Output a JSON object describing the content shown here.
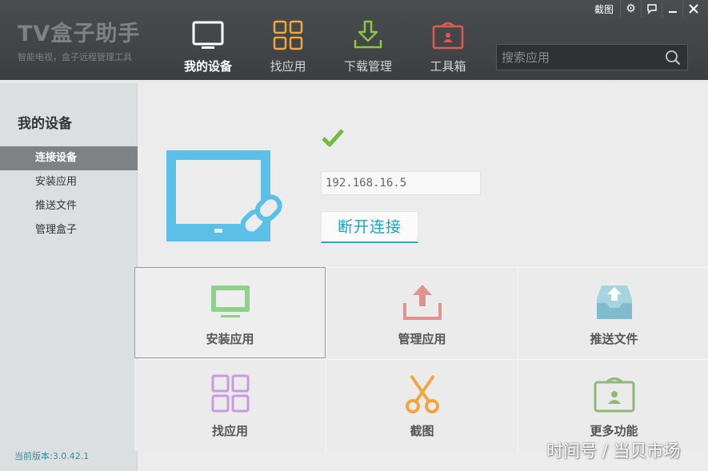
{
  "app": {
    "title": "TV盒子助手",
    "subtitle": "智能电视，盒子远程管理工具"
  },
  "window_controls": {
    "screenshot_label": "截图",
    "icons": [
      "gear-icon",
      "chat-icon",
      "minimize-icon",
      "close-icon"
    ]
  },
  "nav": {
    "tabs": [
      {
        "label": "我的设备",
        "icon": "tv-icon",
        "active": true
      },
      {
        "label": "找应用",
        "icon": "grid-icon",
        "active": false
      },
      {
        "label": "下载管理",
        "icon": "download-icon",
        "active": false
      },
      {
        "label": "工具箱",
        "icon": "toolbox-icon",
        "active": false
      }
    ]
  },
  "search": {
    "placeholder": "搜索应用",
    "value": ""
  },
  "sidebar": {
    "title": "我的设备",
    "items": [
      {
        "label": "连接设备",
        "active": true
      },
      {
        "label": "安装应用",
        "active": false
      },
      {
        "label": "推送文件",
        "active": false
      },
      {
        "label": "管理盒子",
        "active": false
      }
    ],
    "version": "当前版本:3.0.42.1"
  },
  "device": {
    "ip": "192.168.16.5",
    "disconnect_label": "断开连接",
    "status": "connected"
  },
  "tiles": [
    {
      "label": "安装应用",
      "icon": "monitor-icon",
      "color": "#8fd18a"
    },
    {
      "label": "管理应用",
      "icon": "upload-icon",
      "color": "#e0938e"
    },
    {
      "label": "推送文件",
      "icon": "inbox-icon",
      "color": "#8fc6d4"
    },
    {
      "label": "找应用",
      "icon": "grid-icon",
      "color": "#c89ae0"
    },
    {
      "label": "截图",
      "icon": "scissors-icon",
      "color": "#f0a742"
    },
    {
      "label": "更多功能",
      "icon": "toolbox-icon",
      "color": "#8fb878"
    }
  ],
  "watermark": "时间号 / 当贝市场",
  "colors": {
    "header_bg": "#404346",
    "accent": "#25a9c8",
    "tv_blue": "#5bc0e8",
    "check_green": "#6cbf3a"
  }
}
